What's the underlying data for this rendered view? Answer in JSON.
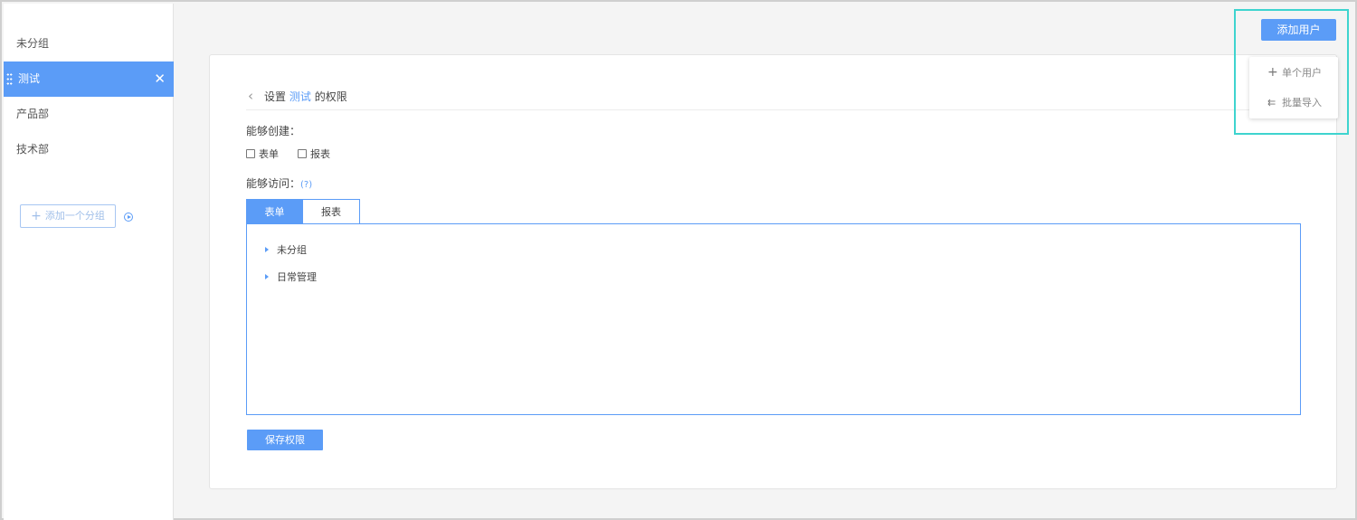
{
  "sidebar": {
    "groups": [
      {
        "label": "未分组",
        "active": false
      },
      {
        "label": "测试",
        "active": true
      },
      {
        "label": "产品部",
        "active": false
      },
      {
        "label": "技术部",
        "active": false
      }
    ],
    "close_glyph": "✕",
    "add_group_label": "添加一个分组",
    "add_group_plus": "+"
  },
  "header": {
    "add_user_label": "添加用户",
    "dropdown": {
      "single_user_label": "单个用户",
      "single_user_icon": "plus-icon",
      "single_user_glyph": "+",
      "batch_import_label": "批量导入",
      "batch_import_icon": "reply-all-icon",
      "batch_import_glyph": "⇇"
    }
  },
  "main": {
    "back_glyph": "‹",
    "title_prefix": "设置",
    "title_group": "测试",
    "title_suffix": "的权限",
    "can_create_label": "能够创建：",
    "create_options": [
      {
        "label": "表单",
        "checked": false
      },
      {
        "label": "报表",
        "checked": false
      }
    ],
    "can_access_label": "能够访问：",
    "help_label": "(?)",
    "tabs": [
      {
        "label": "表单",
        "active": true
      },
      {
        "label": "报表",
        "active": false
      }
    ],
    "tree_nodes": [
      {
        "label": "未分组"
      },
      {
        "label": "日常管理"
      }
    ],
    "save_label": "保存权限"
  },
  "colors": {
    "accent": "#5b9cf7",
    "highlight": "#3ed4cf",
    "background": "#f4f4f4"
  }
}
